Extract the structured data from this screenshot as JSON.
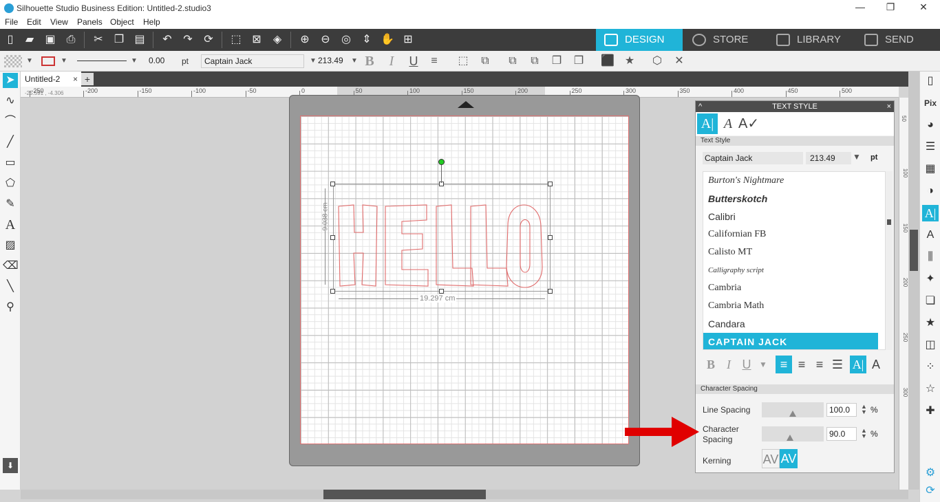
{
  "window": {
    "title": "Silhouette Studio Business Edition: Untitled-2.studio3"
  },
  "menu": [
    "File",
    "Edit",
    "View",
    "Panels",
    "Object",
    "Help"
  ],
  "nav_tabs": [
    "DESIGN",
    "STORE",
    "LIBRARY",
    "SEND"
  ],
  "toolbar2": {
    "line_width": "0.00",
    "line_unit": "pt",
    "font_name": "Captain Jack",
    "font_size": "213.49",
    "bold": "B",
    "italic": "I",
    "underline": "U"
  },
  "document": {
    "tab_label": "Untitled-2",
    "close": "×",
    "add": "+",
    "mouse_position": "-25.591 , -4.306",
    "height_label": "9.038 cm",
    "width_label": "19.297 cm",
    "text": "HELLO"
  },
  "ruler": {
    "h_ticks": [
      "-250",
      "-200",
      "-150",
      "-100",
      "-50",
      "0",
      "50",
      "100",
      "150",
      "200",
      "250",
      "300",
      "350",
      "400",
      "450",
      "500"
    ],
    "v_ticks": [
      "50",
      "100",
      "150",
      "200",
      "250",
      "300"
    ]
  },
  "text_style_panel": {
    "title": "TEXT STYLE",
    "minimize": "^",
    "close": "×",
    "section_text_style": "Text Style",
    "font_name": "Captain Jack",
    "font_size": "213.49",
    "size_unit": "pt",
    "fonts": [
      "Burton's Nightmare",
      "Butterskotch",
      "Calibri",
      "Californian FB",
      "Calisto MT",
      "Calligraphy script",
      "Cambria",
      "Cambria Math",
      "Candara",
      "CAPTAIN JACK"
    ],
    "selected_font": "CAPTAIN JACK",
    "section_char_spacing": "Character Spacing",
    "line_spacing_label": "Line Spacing",
    "line_spacing_value": "100.0",
    "line_spacing_level": 0.5,
    "char_spacing_label_1": "Character",
    "char_spacing_label_2": "Spacing",
    "char_spacing_value": "90.0",
    "char_spacing_level": 0.45,
    "percent": "%",
    "kerning_label": "Kerning",
    "kerning_off": "AV",
    "kerning_on": "AV"
  },
  "colors": {
    "accent": "#20b4d8",
    "toolbar_dark": "#3c3c3c",
    "cut_line": "#e07070",
    "annotation_arrow": "#e00000"
  }
}
